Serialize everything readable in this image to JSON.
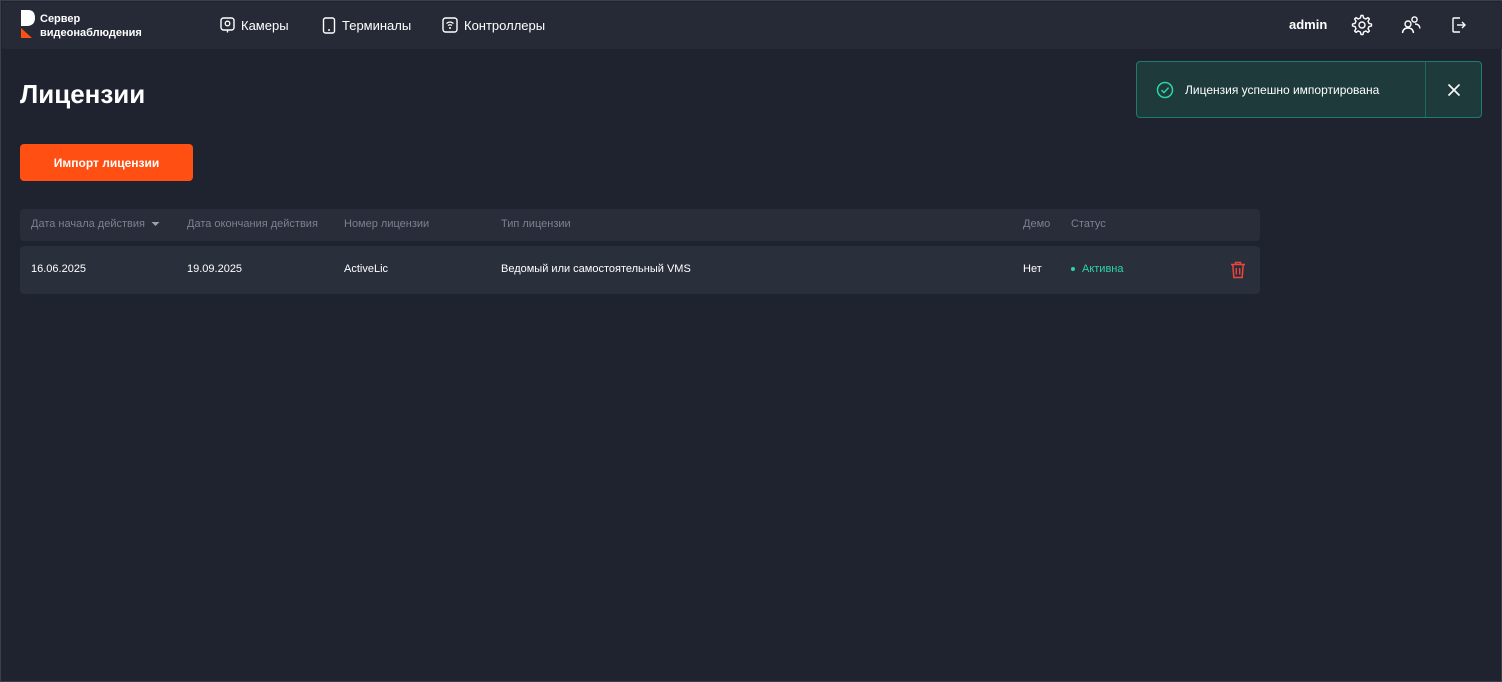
{
  "app": {
    "logo_line1": "Сервер",
    "logo_line2": "видеонаблюдения"
  },
  "nav": {
    "cameras": "Камеры",
    "terminals": "Терминалы",
    "controllers": "Контроллеры"
  },
  "user": {
    "name": "admin"
  },
  "page": {
    "title": "Лицензии",
    "import_button": "Импорт лицензии"
  },
  "table": {
    "columns": {
      "start_date": "Дата начала действия",
      "end_date": "Дата окончания действия",
      "number": "Номер лицензии",
      "type": "Тип лицензии",
      "demo": "Демо",
      "status": "Статус"
    },
    "rows": [
      {
        "start_date": "16.06.2025",
        "end_date": "19.09.2025",
        "number": "ActiveLic",
        "type": "Ведомый или самостоятельный VMS",
        "demo": "Нет",
        "status": "Активна"
      }
    ]
  },
  "toast": {
    "message": "Лицензия успешно импортирована"
  },
  "colors": {
    "accent": "#ff4f12",
    "status_active": "#2dd4a6",
    "delete": "#f04438"
  }
}
